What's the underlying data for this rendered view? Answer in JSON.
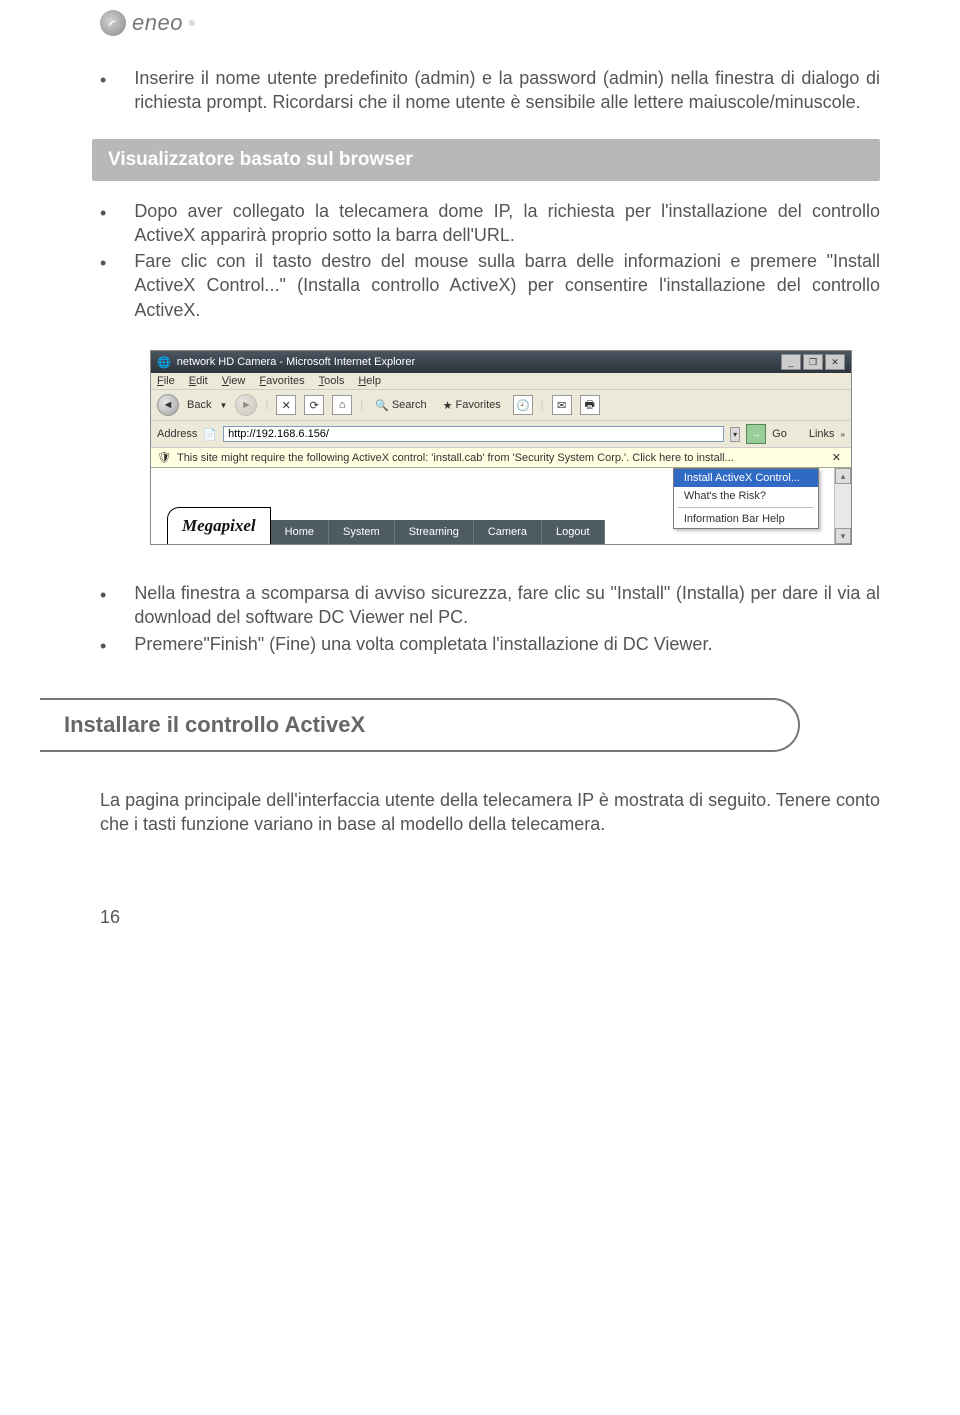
{
  "logo": {
    "text": "eneo"
  },
  "intro_bullets": [
    "Inserire il nome utente predefinito (admin) e la password (admin) nella finestra di dialogo di richiesta prompt. Ricordarsi che il nome utente è sensibile alle lettere maiuscole/minuscole."
  ],
  "section1_title": "Visualizzatore basato sul browser",
  "section1_bullets": [
    "Dopo aver collegato la telecamera dome IP, la richiesta per l'installazione del controllo ActiveX apparirà proprio sotto la barra dell'URL.",
    "Fare clic con il tasto destro del mouse sulla barra delle informazioni e premere \"Install ActiveX Control...\" (Installa controllo ActiveX) per consentire l'installazione del controllo ActiveX."
  ],
  "screenshot": {
    "title": "network HD Camera - Microsoft Internet Explorer",
    "menu": [
      "File",
      "Edit",
      "View",
      "Favorites",
      "Tools",
      "Help"
    ],
    "toolbar": {
      "back": "Back",
      "search": "Search",
      "favorites": "Favorites"
    },
    "address_label": "Address",
    "address_value": "http://192.168.6.156/",
    "go": "Go",
    "links": "Links",
    "infobar": "This site might require the following ActiveX control: 'install.cab' from 'Security System Corp.'. Click here to install...",
    "context_menu": {
      "install": "Install ActiveX Control...",
      "risk": "What's the Risk?",
      "help": "Information Bar Help"
    },
    "tabs": {
      "logo": "Megapixel",
      "items": [
        "Home",
        "System",
        "Streaming",
        "Camera",
        "Logout"
      ]
    }
  },
  "section1b_bullets": [
    "Nella finestra a scomparsa di avviso sicurezza, fare clic su \"Install\" (Installa) per dare il via al download del software DC Viewer nel PC.",
    "Premere\"Finish\" (Fine) una volta completata l'installazione di DC Viewer."
  ],
  "pill_heading": "Installare il controllo ActiveX",
  "closing_para": "La pagina principale dell'interfaccia utente della telecamera IP è mostrata di seguito. Tenere conto che i tasti funzione variano in base al modello della telecamera.",
  "page_number": "16"
}
